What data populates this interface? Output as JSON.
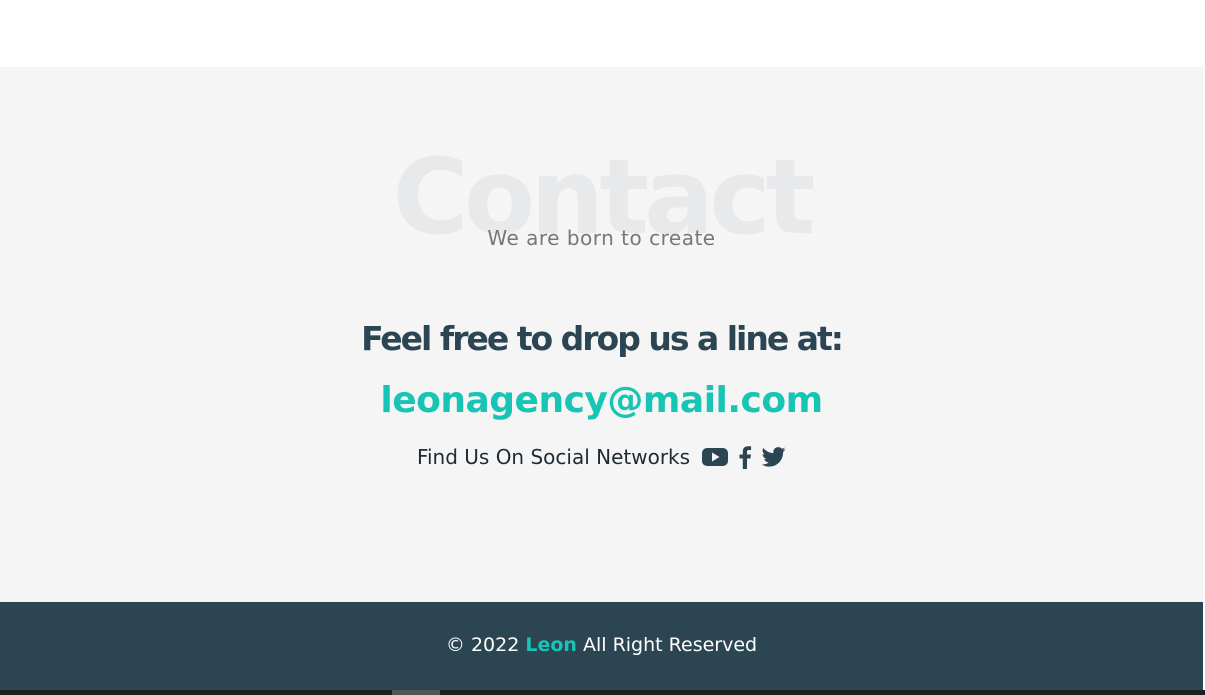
{
  "contact": {
    "background_word": "Contact",
    "tagline": "We are born to create",
    "headline": "Feel free to drop us a line at:",
    "email": "leonagency@mail.com"
  },
  "social": {
    "label": "Find Us On Social Networks",
    "icons": [
      "youtube-icon",
      "facebook-icon",
      "twitter-icon"
    ]
  },
  "footer": {
    "copyright_prefix": "© 2022",
    "brand": "Leon",
    "suffix": "All Right Reserved"
  },
  "colors": {
    "accent": "#18c4b3",
    "dark": "#2c4553",
    "section_bg": "#f5f5f5"
  }
}
